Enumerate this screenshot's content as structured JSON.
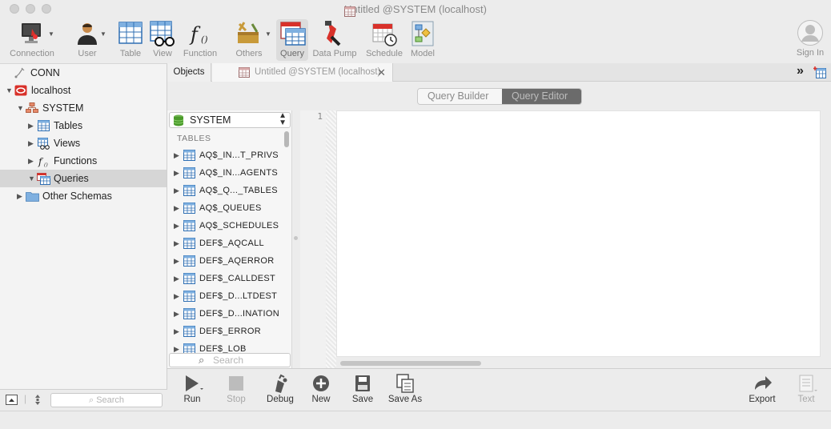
{
  "window": {
    "title": "Untitled @SYSTEM (localhost)"
  },
  "toolbar": {
    "items": [
      {
        "label": "Connection"
      },
      {
        "label": "User"
      },
      {
        "label": "Table"
      },
      {
        "label": "View"
      },
      {
        "label": "Function"
      },
      {
        "label": "Others"
      },
      {
        "label": "Query"
      },
      {
        "label": "Data Pump"
      },
      {
        "label": "Schedule"
      },
      {
        "label": "Model"
      }
    ],
    "sign_in": "Sign In"
  },
  "sidebar": {
    "tree": [
      {
        "label": "CONN"
      },
      {
        "label": "localhost"
      },
      {
        "label": "SYSTEM"
      },
      {
        "label": "Tables"
      },
      {
        "label": "Views"
      },
      {
        "label": "Functions"
      },
      {
        "label": "Queries"
      },
      {
        "label": "Other Schemas"
      }
    ],
    "search_placeholder": "Search"
  },
  "tabs": {
    "objects": "Objects",
    "untitled": "Untitled @SYSTEM (localhost)"
  },
  "segmented": {
    "builder": "Query Builder",
    "editor": "Query Editor"
  },
  "object_panel": {
    "schema": "SYSTEM",
    "section": "TABLES",
    "tables": [
      "AQ$_IN...T_PRIVS",
      "AQ$_IN...AGENTS",
      "AQ$_Q..._TABLES",
      "AQ$_QUEUES",
      "AQ$_SCHEDULES",
      "DEF$_AQCALL",
      "DEF$_AQERROR",
      "DEF$_CALLDEST",
      "DEF$_D...LTDEST",
      "DEF$_D...INATION",
      "DEF$_ERROR",
      "DEF$_LOB"
    ],
    "search_placeholder": "Search"
  },
  "editor": {
    "line_number": "1"
  },
  "bottom_toolbar": {
    "run": "Run",
    "stop": "Stop",
    "debug": "Debug",
    "new": "New",
    "save": "Save",
    "save_as": "Save As",
    "export": "Export",
    "text": "Text"
  },
  "colors": {
    "accent_red": "#d8312a",
    "table_blue": "#2f6fb3",
    "selected_seg": "#6b6b6b"
  }
}
